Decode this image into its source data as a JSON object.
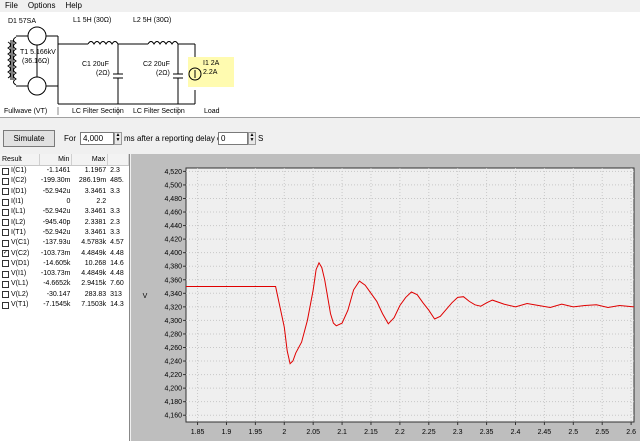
{
  "menu": [
    "File",
    "Options",
    "Help"
  ],
  "schematic": {
    "d1": "D1 57SA",
    "t1_name": "T1 5.166kV",
    "t1_res": "(36.16Ω)",
    "l1": "L1 5H (30Ω)",
    "l2": "L2 5H (30Ω)",
    "c1_name": "C1 20uF",
    "c1_res": "(2Ω)",
    "c2_name": "C2 20uF",
    "c2_res": "(2Ω)",
    "i1_name": "I1 2A",
    "i1_val": "2.2A",
    "label_fullwave": "Fullwave (VT)",
    "label_lc1": "LC Filter Section",
    "label_lc2": "LC Filter Section",
    "label_load": "Load"
  },
  "controls": {
    "simulate": "Simulate",
    "for": "For",
    "duration": "4,000",
    "ms": "ms",
    "after": "after a reporting delay of",
    "delay": "0",
    "s": "S"
  },
  "results": {
    "headers": [
      "Result",
      "Min",
      "Max",
      ""
    ],
    "rows": [
      {
        "name": "I(C1)",
        "min": "-1.1461",
        "max": "1.1967",
        "extra": "2.3",
        "checked": false
      },
      {
        "name": "I(C2)",
        "min": "-199.30m",
        "max": "286.19m",
        "extra": "485.",
        "checked": false
      },
      {
        "name": "I(D1)",
        "min": "-52.942u",
        "max": "3.3461",
        "extra": "3.3",
        "checked": false
      },
      {
        "name": "I(I1)",
        "min": "0",
        "max": "2.2",
        "extra": "",
        "checked": false
      },
      {
        "name": "I(L1)",
        "min": "-52.942u",
        "max": "3.3461",
        "extra": "3.3",
        "checked": false
      },
      {
        "name": "I(L2)",
        "min": "-945.40p",
        "max": "2.3381",
        "extra": "2.3",
        "checked": false
      },
      {
        "name": "I(T1)",
        "min": "-52.942u",
        "max": "3.3461",
        "extra": "3.3",
        "checked": false
      },
      {
        "name": "V(C1)",
        "min": "-137.93u",
        "max": "4.5783k",
        "extra": "4.57",
        "checked": false
      },
      {
        "name": "V(C2)",
        "min": "-103.73m",
        "max": "4.4849k",
        "extra": "4.48",
        "checked": true
      },
      {
        "name": "V(D1)",
        "min": "-14.605k",
        "max": "10.268",
        "extra": "14.6",
        "checked": false
      },
      {
        "name": "V(I1)",
        "min": "-103.73m",
        "max": "4.4849k",
        "extra": "4.48",
        "checked": false
      },
      {
        "name": "V(L1)",
        "min": "-4.6652k",
        "max": "2.9415k",
        "extra": "7.60",
        "checked": false
      },
      {
        "name": "V(L2)",
        "min": "-30.147",
        "max": "283.83",
        "extra": "313",
        "checked": false
      },
      {
        "name": "V(T1)",
        "min": "-7.1545k",
        "max": "7.1503k",
        "extra": "14.3",
        "checked": false
      }
    ]
  },
  "chart_data": {
    "type": "line",
    "title": "",
    "xlabel": "",
    "ylabel": "V",
    "xlim": [
      1.83,
      2.605
    ],
    "ylim": [
      4150,
      4525
    ],
    "xticks": [
      "1.85",
      "1.9",
      "1.95",
      "2",
      "2.05",
      "2.1",
      "2.15",
      "2.2",
      "2.25",
      "2.3",
      "2.35",
      "2.4",
      "2.45",
      "2.5",
      "2.55",
      "2.6"
    ],
    "yticks": [
      "4,520",
      "4,500",
      "4,480",
      "4,460",
      "4,440",
      "4,420",
      "4,400",
      "4,380",
      "4,360",
      "4,340",
      "4,320",
      "4,300",
      "4,280",
      "4,260",
      "4,240",
      "4,220",
      "4,200",
      "4,180",
      "4,160"
    ],
    "grid": true,
    "series": [
      {
        "color": "#e00000",
        "x": [
          1.83,
          1.85,
          1.9,
          1.95,
          1.985,
          1.99,
          2.0,
          2.005,
          2.01,
          2.015,
          2.02,
          2.03,
          2.04,
          2.05,
          2.055,
          2.06,
          2.065,
          2.07,
          2.075,
          2.08,
          2.085,
          2.09,
          2.1,
          2.11,
          2.12,
          2.13,
          2.14,
          2.15,
          2.16,
          2.17,
          2.18,
          2.19,
          2.2,
          2.21,
          2.22,
          2.23,
          2.24,
          2.25,
          2.26,
          2.27,
          2.28,
          2.29,
          2.3,
          2.31,
          2.32,
          2.33,
          2.34,
          2.35,
          2.36,
          2.38,
          2.4,
          2.42,
          2.44,
          2.46,
          2.48,
          2.5,
          2.52,
          2.54,
          2.56,
          2.58,
          2.605
        ],
        "y": [
          4350,
          4350,
          4350,
          4350,
          4350,
          4330,
          4290,
          4255,
          4236,
          4240,
          4252,
          4268,
          4300,
          4345,
          4375,
          4385,
          4378,
          4360,
          4335,
          4310,
          4296,
          4292,
          4296,
          4315,
          4345,
          4358,
          4352,
          4340,
          4328,
          4310,
          4295,
          4304,
          4322,
          4334,
          4342,
          4338,
          4326,
          4315,
          4302,
          4306,
          4316,
          4326,
          4334,
          4335,
          4328,
          4323,
          4321,
          4326,
          4330,
          4324,
          4320,
          4325,
          4322,
          4319,
          4324,
          4320,
          4322,
          4323,
          4319,
          4322,
          4320
        ]
      }
    ]
  }
}
